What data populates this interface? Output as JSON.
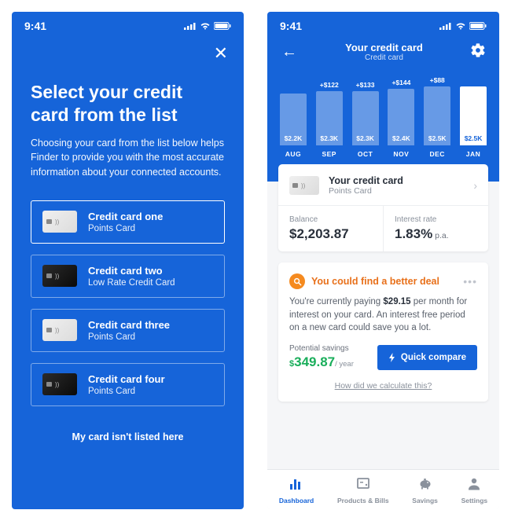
{
  "status": {
    "time": "9:41"
  },
  "screen1": {
    "title": "Select your credit card from the list",
    "description": "Choosing your card from the list below helps Finder to provide you with the most accurate information about your connected accounts.",
    "options": [
      {
        "name": "Credit card one",
        "type": "Points Card",
        "look": "light",
        "selected": true
      },
      {
        "name": "Credit card two",
        "type": "Low Rate Credit Card",
        "look": "dark",
        "selected": false
      },
      {
        "name": "Credit card three",
        "type": "Points Card",
        "look": "light",
        "selected": false
      },
      {
        "name": "Credit card four",
        "type": "Points Card",
        "look": "dark",
        "selected": false
      }
    ],
    "not_listed": "My card isn't listed here"
  },
  "screen2": {
    "header": {
      "title": "Your credit card",
      "subtitle": "Credit card"
    },
    "card": {
      "name": "Your credit card",
      "type": "Points Card"
    },
    "balance": {
      "label": "Balance",
      "value": "$2,203.87"
    },
    "interest": {
      "label": "Interest rate",
      "value": "1.83%",
      "unit": " p.a."
    },
    "deal": {
      "title": "You could find a better deal",
      "body_pre": "You're currently paying ",
      "body_bold": "$29.15",
      "body_post": " per month for interest on your card. An interest free period on a new card could save you a lot.",
      "savings_label": "Potential savings",
      "savings_value": "349.87",
      "savings_prefix": "$",
      "savings_unit": "/ year",
      "compare": "Quick compare",
      "calc_link": "How did we calculate this?"
    },
    "tabs": [
      {
        "id": "dashboard",
        "label": "Dashboard",
        "active": true
      },
      {
        "id": "products",
        "label": "Products & Bills",
        "active": false
      },
      {
        "id": "savings",
        "label": "Savings",
        "active": false
      },
      {
        "id": "settings",
        "label": "Settings",
        "active": false
      }
    ]
  },
  "chart_data": {
    "type": "bar",
    "categories": [
      "AUG",
      "SEP",
      "OCT",
      "NOV",
      "DEC",
      "JAN"
    ],
    "values": [
      2200,
      2300,
      2300,
      2400,
      2500,
      2500
    ],
    "value_labels": [
      "$2.2K",
      "$2.3K",
      "$2.3K",
      "$2.4K",
      "$2.5K",
      "$2.5K"
    ],
    "deltas": [
      "",
      "+$122",
      "+$133",
      "+$144",
      "+$88",
      ""
    ],
    "active_index": 5,
    "ylim": [
      0,
      2600
    ]
  }
}
